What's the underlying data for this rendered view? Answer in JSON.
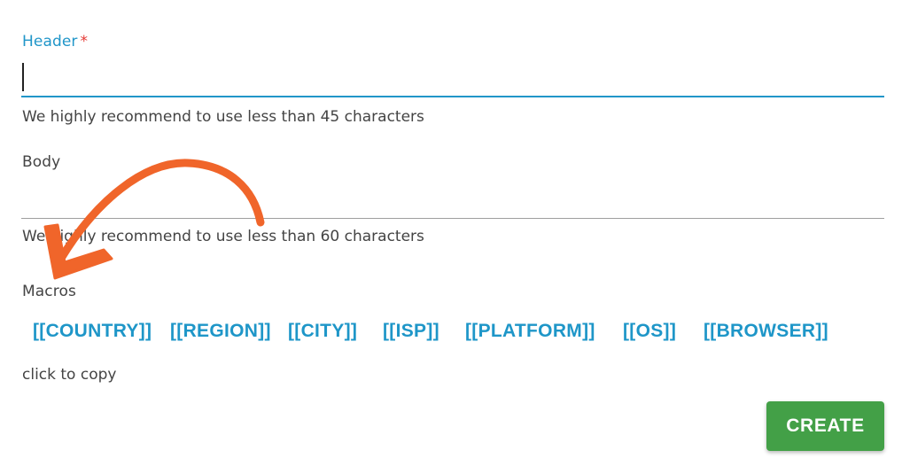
{
  "form": {
    "header": {
      "label": "Header",
      "required_mark": "*",
      "value": "",
      "helper": "We highly recommend to use less than 45 characters"
    },
    "body": {
      "label": "Body",
      "value": "",
      "helper": "We highly recommend to use less than 60 characters"
    },
    "macros": {
      "label": "Macros",
      "items": [
        "[[COUNTRY]]",
        "[[REGION]]",
        "[[CITY]]",
        "[[ISP]]",
        "[[PLATFORM]]",
        "[[OS]]",
        "[[BROWSER]]"
      ],
      "hint": "click to copy"
    },
    "create_label": "CREATE"
  },
  "colors": {
    "accent": "#2196c9",
    "required": "#e53935",
    "macro": "#1e96c8",
    "button": "#43a047",
    "annotation_arrow": "#f0652a"
  },
  "annotation": {
    "icon": "curved-arrow-icon"
  }
}
